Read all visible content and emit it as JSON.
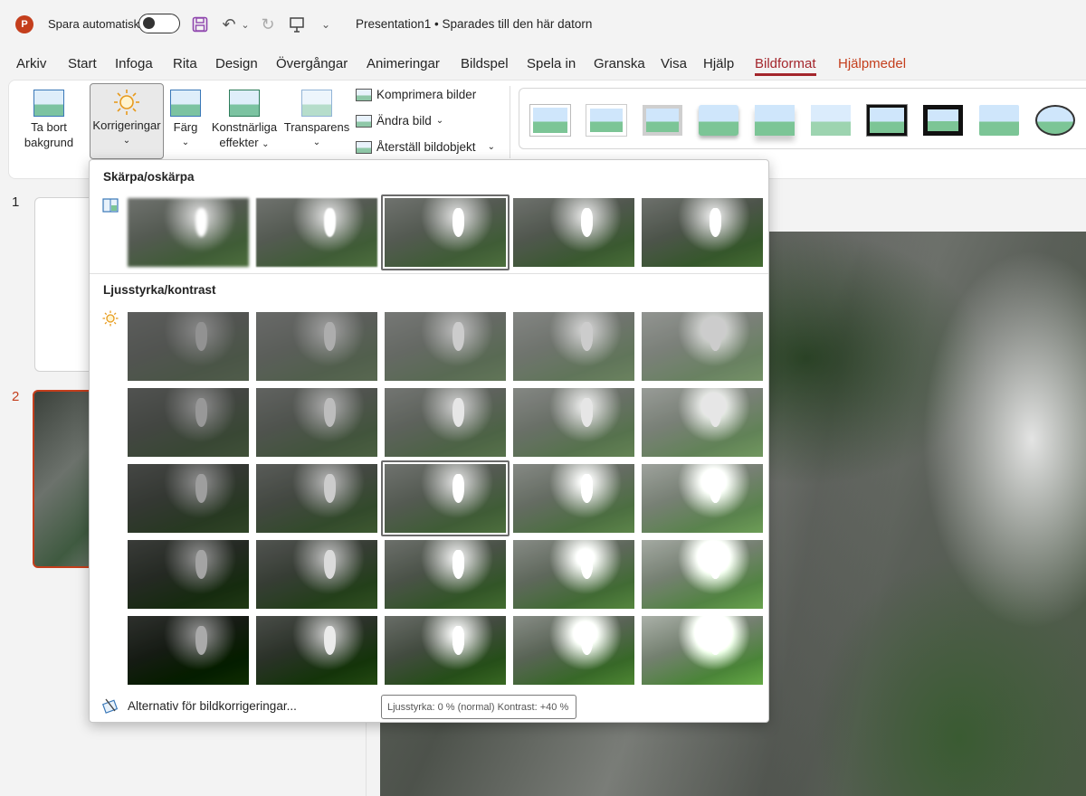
{
  "titlebar": {
    "autosave_label": "Spara automatiskt",
    "autosave_state": "off",
    "doc_title": "Presentation1 • Sparades till den här datorn"
  },
  "tabs": [
    "Arkiv",
    "Start",
    "Infoga",
    "Rita",
    "Design",
    "Övergångar",
    "Animeringar",
    "Bildspel",
    "Spela in",
    "Granska",
    "Visa",
    "Hjälp",
    "Bildformat",
    "Hjälpmedel"
  ],
  "active_tab": "Bildformat",
  "ribbon": {
    "remove_bg": {
      "line1": "Ta bort",
      "line2": "bakgrund"
    },
    "corrections": {
      "label": "Korrigeringar"
    },
    "color": {
      "label": "Färg"
    },
    "artistic": {
      "line1": "Konstnärliga",
      "line2": "effekter"
    },
    "transparency": {
      "label": "Transparens"
    },
    "compress": "Komprimera bilder",
    "change_pic": "Ändra bild",
    "reset_pic": "Återställ bildobjekt"
  },
  "slides": {
    "num1": "1",
    "num2": "2"
  },
  "dropdown": {
    "sharpen_title": "Skärpa/oskärpa",
    "brightness_title": "Ljusstyrka/kontrast",
    "options_link": "Alternativ för bildkorrigeringar...",
    "sharpness_selected_index": 2,
    "brightness_rows": 5,
    "brightness_cols": 5,
    "brightness_selected": [
      2,
      2
    ]
  },
  "tooltip": "Ljusstyrka: 0 % (normal) Kontrast: +40 %",
  "colors": {
    "accent": "#c43e1c",
    "active_tab": "#a4262c"
  }
}
